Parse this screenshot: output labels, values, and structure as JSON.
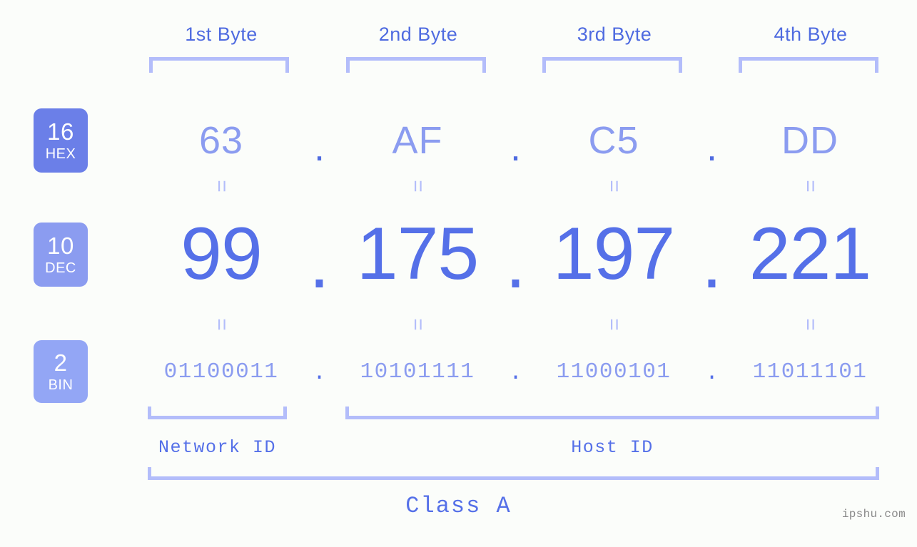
{
  "watermark": "ipshu.com",
  "byte_headers": [
    {
      "label": "1st Byte"
    },
    {
      "label": "2nd Byte"
    },
    {
      "label": "3rd Byte"
    },
    {
      "label": "4th Byte"
    }
  ],
  "separator": ".",
  "equals_glyph": "=",
  "rows": {
    "hex": {
      "badge_num": "16",
      "badge_base": "HEX",
      "values": [
        "63",
        "AF",
        "C5",
        "DD"
      ]
    },
    "dec": {
      "badge_num": "10",
      "badge_base": "DEC",
      "values": [
        "99",
        "175",
        "197",
        "221"
      ]
    },
    "bin": {
      "badge_num": "2",
      "badge_base": "BIN",
      "values": [
        "01100011",
        "10101111",
        "11000101",
        "11011101"
      ]
    }
  },
  "segments": {
    "network_id": "Network ID",
    "host_id": "Host ID",
    "class": "Class A"
  },
  "colors": {
    "background": "#fbfdfa",
    "badge_hex": "#6b7fe8",
    "badge_dec": "#8b9cf0",
    "badge_bin": "#93a6f5",
    "bracket": "#b3bdfa",
    "text_strong": "#5570e8",
    "text_light": "#8b9cf0",
    "header": "#4f6be0",
    "watermark": "#8a8a8a"
  }
}
